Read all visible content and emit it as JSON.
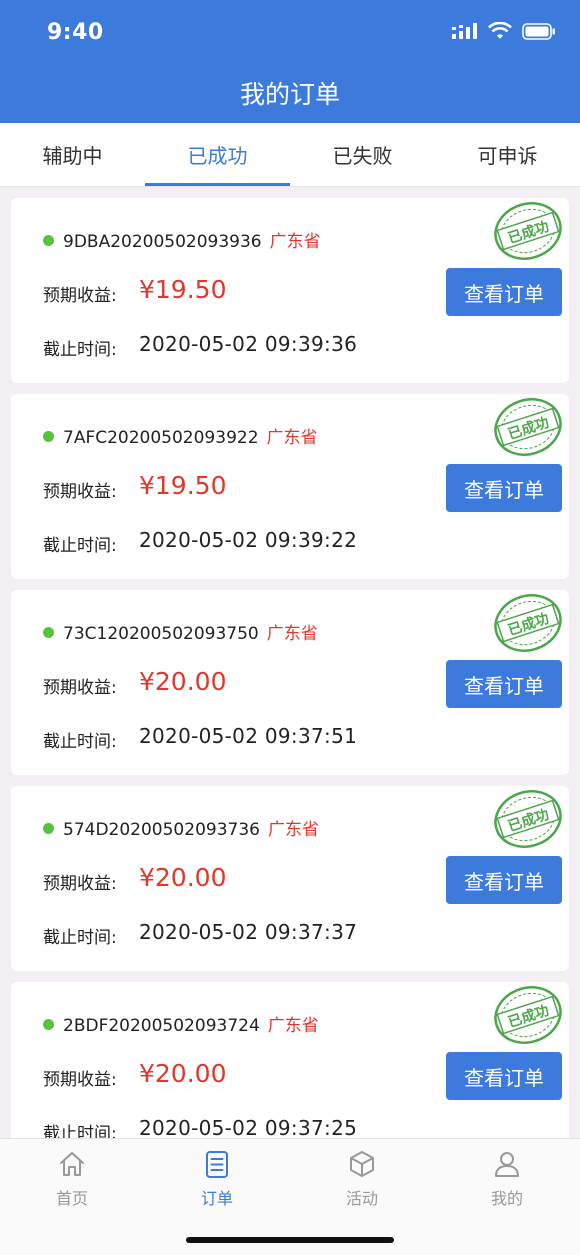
{
  "status_bar": {
    "time": "9:40"
  },
  "nav": {
    "title": "我的订单"
  },
  "tabs": [
    {
      "label": "辅助中",
      "active": false
    },
    {
      "label": "已成功",
      "active": true
    },
    {
      "label": "已失败",
      "active": false
    },
    {
      "label": "可申诉",
      "active": false
    }
  ],
  "labels": {
    "expected_income": "预期收益:",
    "deadline": "截止时间:",
    "view_order": "查看订单",
    "stamp": "已成功"
  },
  "orders": [
    {
      "order_no": "9DBA20200502093936",
      "province": "广东省",
      "amount": "¥19.50",
      "deadline": "2020-05-02 09:39:36"
    },
    {
      "order_no": "7AFC20200502093922",
      "province": "广东省",
      "amount": "¥19.50",
      "deadline": "2020-05-02 09:39:22"
    },
    {
      "order_no": "73C120200502093750",
      "province": "广东省",
      "amount": "¥20.00",
      "deadline": "2020-05-02 09:37:51"
    },
    {
      "order_no": "574D20200502093736",
      "province": "广东省",
      "amount": "¥20.00",
      "deadline": "2020-05-02 09:37:37"
    },
    {
      "order_no": "2BDF20200502093724",
      "province": "广东省",
      "amount": "¥20.00",
      "deadline": "2020-05-02 09:37:25"
    }
  ],
  "tabbar": [
    {
      "label": "首页",
      "icon": "home-icon",
      "active": false
    },
    {
      "label": "订单",
      "icon": "order-list-icon",
      "active": true
    },
    {
      "label": "活动",
      "icon": "box-icon",
      "active": false
    },
    {
      "label": "我的",
      "icon": "user-icon",
      "active": false
    }
  ],
  "colors": {
    "primary": "#3c7bdc",
    "price": "#e0392c",
    "success_dot": "#55c43c",
    "stamp": "#4ca64a"
  }
}
